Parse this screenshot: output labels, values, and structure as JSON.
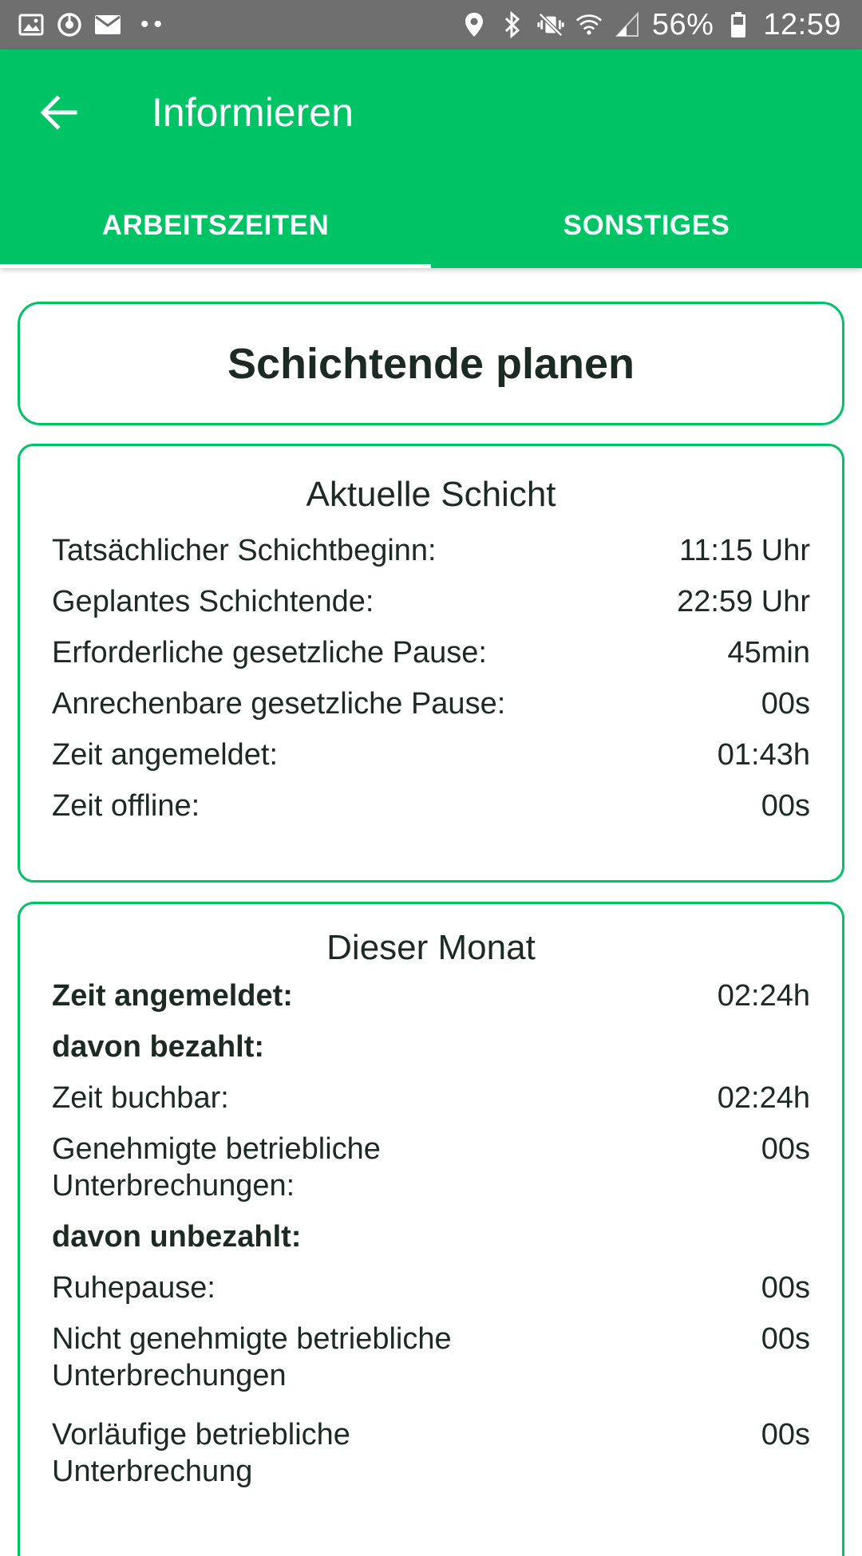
{
  "status_bar": {
    "battery": "56%",
    "time": "12:59"
  },
  "app_bar": {
    "title": "Informieren"
  },
  "tabs": [
    {
      "label": "ARBEITSZEITEN",
      "active": true
    },
    {
      "label": "SONSTIGES",
      "active": false
    }
  ],
  "plan_button": {
    "label": "Schichtende planen"
  },
  "current_shift": {
    "title": "Aktuelle Schicht",
    "rows": [
      {
        "label": "Tatsächlicher Schichtbeginn:",
        "value": "11:15 Uhr"
      },
      {
        "label": "Geplantes Schichtende:",
        "value": "22:59 Uhr"
      },
      {
        "label": "Erforderliche gesetzliche Pause:",
        "value": "45min"
      },
      {
        "label": "Anrechenbare gesetzliche Pause:",
        "value": "00s"
      },
      {
        "label": "Zeit angemeldet:",
        "value": "01:43h"
      },
      {
        "label": "Zeit offline:",
        "value": "00s"
      }
    ]
  },
  "this_month": {
    "title": "Dieser Monat",
    "rows": [
      {
        "label": "Zeit angemeldet:",
        "value": "02:24h"
      },
      {
        "label": "davon bezahlt:",
        "value": ""
      },
      {
        "label": "Zeit buchbar:",
        "value": "02:24h"
      },
      {
        "label": "Genehmigte betriebliche Unterbrechungen:",
        "value": "00s"
      },
      {
        "label": "davon unbezahlt:",
        "value": ""
      },
      {
        "label": "Ruhepause:",
        "value": "00s"
      },
      {
        "label": "Nicht genehmigte betriebliche Unterbrechungen",
        "value": "00s"
      },
      {
        "label": "Vorläufige betriebliche Unterbrechung",
        "value": "00s"
      }
    ]
  }
}
